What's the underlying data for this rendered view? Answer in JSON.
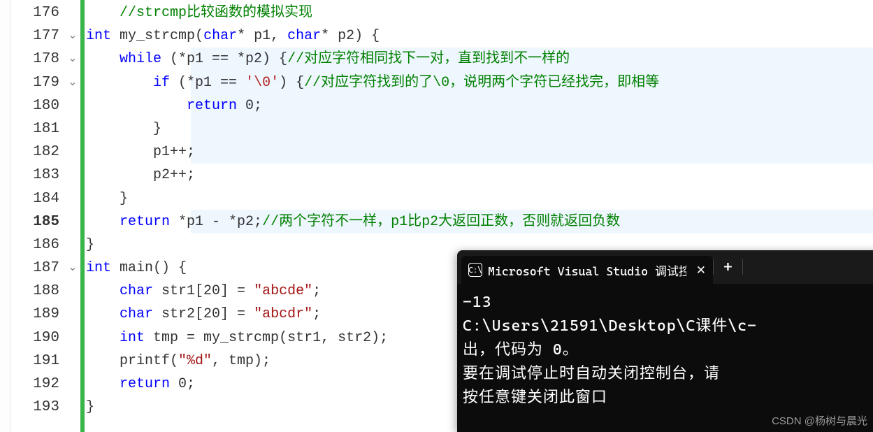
{
  "editor": {
    "lines": [
      {
        "num": "176"
      },
      {
        "num": "177",
        "fold": "⌄"
      },
      {
        "num": "178",
        "fold": "⌄"
      },
      {
        "num": "179",
        "fold": "⌄"
      },
      {
        "num": "180"
      },
      {
        "num": "181"
      },
      {
        "num": "182"
      },
      {
        "num": "183"
      },
      {
        "num": "184"
      },
      {
        "num": "185",
        "current": true
      },
      {
        "num": "186"
      },
      {
        "num": "187",
        "fold": "⌄"
      },
      {
        "num": "188"
      },
      {
        "num": "189"
      },
      {
        "num": "190"
      },
      {
        "num": "191"
      },
      {
        "num": "192"
      },
      {
        "num": "193"
      }
    ]
  },
  "code": {
    "l176_cmt": "//strcmp比较函数的模拟实现",
    "l177_int": "int",
    "l177_fn": " my_strcmp",
    "l177_p1": "(",
    "l177_char1": "char",
    "l177_ptr1": "* p1, ",
    "l177_char2": "char",
    "l177_ptr2": "* p2) {",
    "l178_while": "while",
    "l178_cond": " (*p1 == *p2) {",
    "l178_cmt": "//对应字符相同找下一对，直到找到不一样的",
    "l179_if": "if",
    "l179_cond1": " (*p1 == ",
    "l179_ch": "'\\0'",
    "l179_cond2": ") {",
    "l179_cmt": "//对应字符找到的了\\0，说明两个字符已经找完，即相等",
    "l180_ret": "return",
    "l180_val": " 0;",
    "l181": "}",
    "l182": "p1++;",
    "l183": "p2++;",
    "l184": "}",
    "l185_ret": "return",
    "l185_expr": " *p1 - *p2;",
    "l185_cmt": "//两个字符不一样，p1比p2大返回正数，否则就返回负数",
    "l186": "}",
    "l187_int": "int",
    "l187_main": " main() {",
    "l188_char": "char",
    "l188_decl": " str1[20] = ",
    "l188_str": "\"abcde\"",
    "l188_semi": ";",
    "l189_char": "char",
    "l189_decl": " str2[20] = ",
    "l189_str": "\"abcdr\"",
    "l189_semi": ";",
    "l190_int": "int",
    "l190_decl": " tmp = my_strcmp(str1, str2);",
    "l191_fn": "printf(",
    "l191_str": "\"%d\"",
    "l191_rest": ", tmp);",
    "l192_ret": "return",
    "l192_val": " 0;",
    "l193": "}"
  },
  "terminal": {
    "tabTitle": "Microsoft Visual Studio 调试控",
    "newTab": "+",
    "lines": {
      "l1": "-13",
      "l2": "C:\\Users\\21591\\Desktop\\C课件\\c-",
      "l3": "出，代码为 0。",
      "l4": "要在调试停止时自动关闭控制台，请",
      "l5": "按任意键关闭此窗口"
    }
  },
  "watermark": "CSDN @杨树与晨光"
}
